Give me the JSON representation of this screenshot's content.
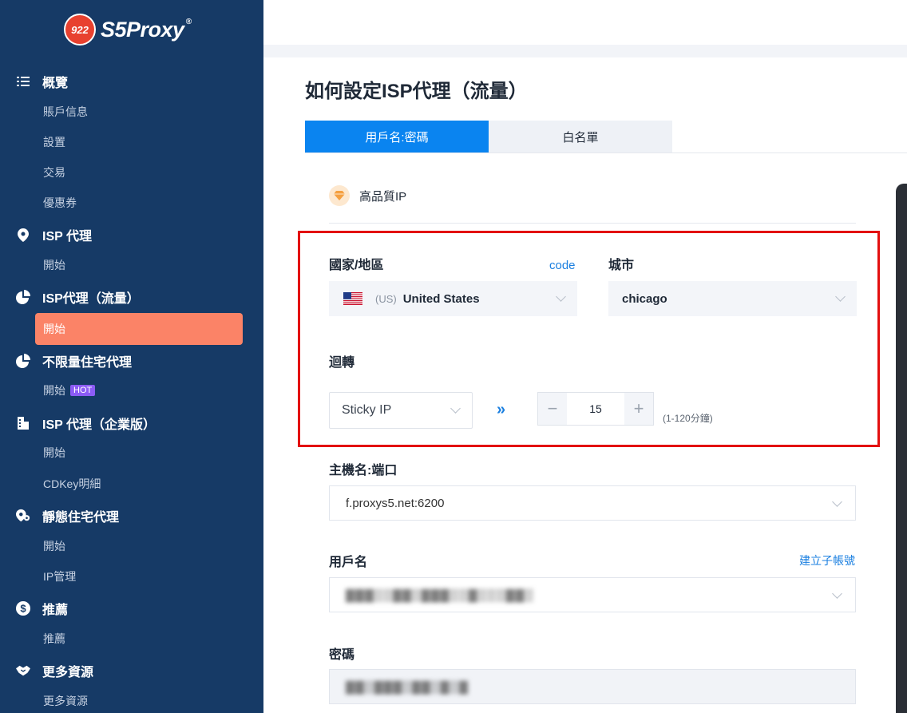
{
  "logo": {
    "badge": "922",
    "name": "S5Proxy",
    "reg": "®"
  },
  "sidebar": {
    "sections": [
      {
        "title": "概覽",
        "icon": "list-icon",
        "items": [
          "賬戶信息",
          "設置",
          "交易",
          "優惠券"
        ]
      },
      {
        "title": "ISP 代理",
        "icon": "location-pin-icon",
        "items": [
          "開始"
        ]
      },
      {
        "title": "ISP代理（流量）",
        "icon": "pie-chart-icon",
        "items": [
          "開始"
        ],
        "active_item": "開始"
      },
      {
        "title": "不限量住宅代理",
        "icon": "pie-chart-icon",
        "items": [
          "開始"
        ],
        "badge": "HOT"
      },
      {
        "title": "ISP 代理（企業版）",
        "icon": "building-icon",
        "items": [
          "開始",
          "CDKey明細"
        ]
      },
      {
        "title": "靜態住宅代理",
        "icon": "location-gear-icon",
        "items": [
          "開始",
          "IP管理"
        ]
      },
      {
        "title": "推薦",
        "icon": "dollar-icon",
        "items": [
          "推薦"
        ]
      },
      {
        "title": "更多資源",
        "icon": "handshake-icon",
        "items": [
          "更多資源"
        ]
      }
    ]
  },
  "page": {
    "title": "如何設定ISP代理（流量）",
    "tabs": [
      {
        "label": "用戶名:密碼",
        "active": true
      },
      {
        "label": "白名單",
        "active": false
      }
    ],
    "quality_label": "高品質IP"
  },
  "form": {
    "country_label": "國家/地區",
    "code_link": "code",
    "country_code": "(US)",
    "country_value": "United States",
    "city_label": "城市",
    "city_value": "chicago",
    "rotation_label": "迴轉",
    "rotation_value": "Sticky IP",
    "arrows": "»",
    "duration_value": "15",
    "duration_range": "(1-120分鐘)",
    "host_label": "主機名:端口",
    "host_value": "f.proxys5.net:6200",
    "username_label": "用戶名",
    "create_sub_link": "建立子帳號",
    "username_value": "▓▓▓▒▒▓▓▒▓▓▓▒▒▓▒▒▒▓▓▒",
    "password_label": "密碼",
    "password_value": "▓▓▒▓▓▓▒▓▓▒▓▒▓"
  },
  "colors": {
    "sidebar": "#163a66",
    "accent": "#0a84f0",
    "active": "#fb8367",
    "highlight": "#e31010"
  }
}
